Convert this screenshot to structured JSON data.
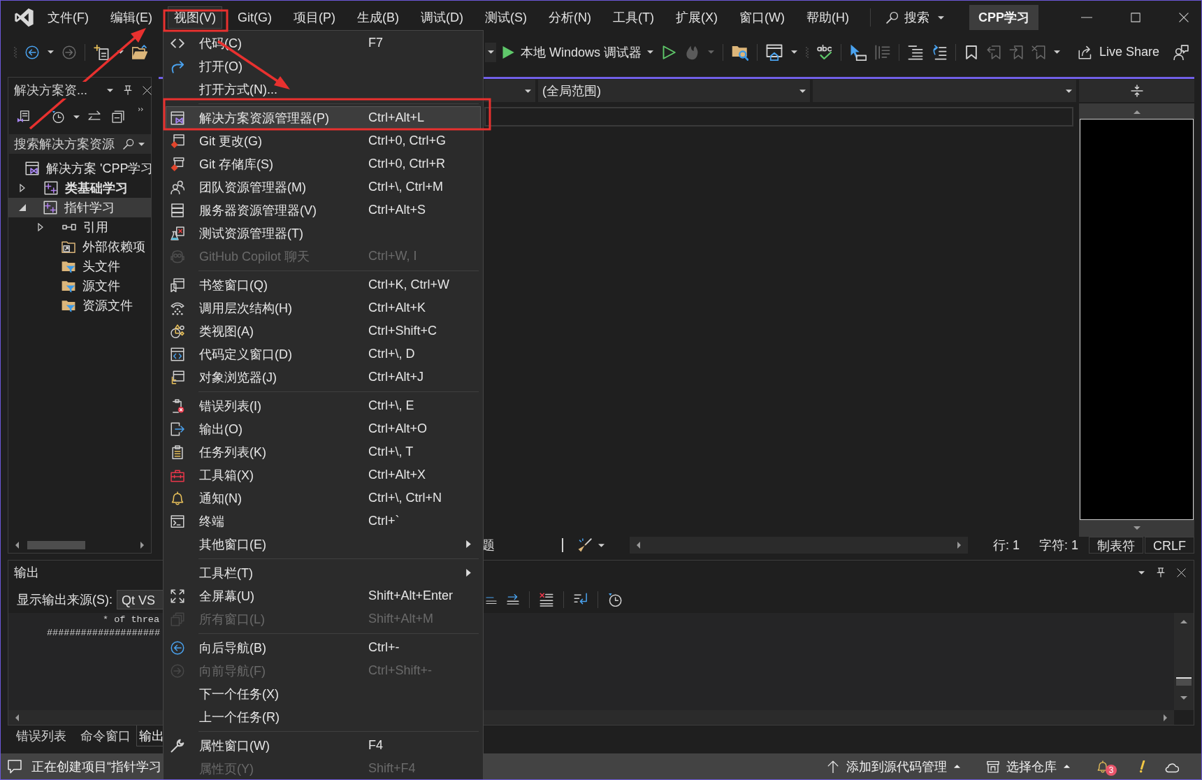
{
  "menu_bar": [
    {
      "label": "文件(F)",
      "selected": false
    },
    {
      "label": "编辑(E)",
      "selected": false
    },
    {
      "label": "视图(V)",
      "selected": true
    },
    {
      "label": "Git(G)",
      "selected": false
    },
    {
      "label": "项目(P)",
      "selected": false
    },
    {
      "label": "生成(B)",
      "selected": false
    },
    {
      "label": "调试(D)",
      "selected": false
    },
    {
      "label": "测试(S)",
      "selected": false
    },
    {
      "label": "分析(N)",
      "selected": false
    },
    {
      "label": "工具(T)",
      "selected": false
    },
    {
      "label": "扩展(X)",
      "selected": false
    },
    {
      "label": "窗口(W)",
      "selected": false
    },
    {
      "label": "帮助(H)",
      "selected": false
    }
  ],
  "search": {
    "label": "搜索"
  },
  "solution_name": "CPP学习",
  "toolbar": {
    "debug_target": "本地 Windows 调试器",
    "live_share": "Live Share"
  },
  "view_menu": {
    "groups": [
      {
        "items": [
          {
            "label": "代码(C)",
            "shortcut": "F7",
            "kind": "command",
            "disabled": false,
            "selected": false
          },
          {
            "label": "打开(O)",
            "kind": "command",
            "disabled": false,
            "selected": false
          },
          {
            "label": "打开方式(N)...",
            "kind": "command",
            "disabled": false,
            "selected": false
          }
        ]
      },
      {
        "items": [
          {
            "label": "解决方案资源管理器(P)",
            "shortcut": "Ctrl+Alt+L",
            "kind": "command",
            "disabled": false,
            "selected": true
          },
          {
            "label": "Git 更改(G)",
            "shortcut": "Ctrl+0, Ctrl+G",
            "kind": "command",
            "disabled": false,
            "selected": false
          },
          {
            "label": "Git 存储库(S)",
            "shortcut": "Ctrl+0, Ctrl+R",
            "kind": "command",
            "disabled": false,
            "selected": false
          },
          {
            "label": "团队资源管理器(M)",
            "shortcut": "Ctrl+\\, Ctrl+M",
            "kind": "command",
            "disabled": false,
            "selected": false
          },
          {
            "label": "服务器资源管理器(V)",
            "shortcut": "Ctrl+Alt+S",
            "kind": "command",
            "disabled": false,
            "selected": false
          },
          {
            "label": "测试资源管理器(T)",
            "kind": "command",
            "disabled": false,
            "selected": false
          },
          {
            "label": "GitHub Copilot 聊天",
            "shortcut": "Ctrl+W, I",
            "kind": "command",
            "disabled": true,
            "selected": false
          }
        ]
      },
      {
        "items": [
          {
            "label": "书签窗口(Q)",
            "shortcut": "Ctrl+K, Ctrl+W",
            "kind": "command",
            "disabled": false,
            "selected": false
          },
          {
            "label": "调用层次结构(H)",
            "shortcut": "Ctrl+Alt+K",
            "kind": "command",
            "disabled": false,
            "selected": false
          },
          {
            "label": "类视图(A)",
            "shortcut": "Ctrl+Shift+C",
            "kind": "command",
            "disabled": false,
            "selected": false
          },
          {
            "label": "代码定义窗口(D)",
            "shortcut": "Ctrl+\\, D",
            "kind": "command",
            "disabled": false,
            "selected": false
          },
          {
            "label": "对象浏览器(J)",
            "shortcut": "Ctrl+Alt+J",
            "kind": "command",
            "disabled": false,
            "selected": false
          }
        ]
      },
      {
        "items": [
          {
            "label": "错误列表(I)",
            "shortcut": "Ctrl+\\, E",
            "kind": "command",
            "disabled": false,
            "selected": false
          },
          {
            "label": "输出(O)",
            "shortcut": "Ctrl+Alt+O",
            "kind": "command",
            "disabled": false,
            "selected": false
          },
          {
            "label": "任务列表(K)",
            "shortcut": "Ctrl+\\, T",
            "kind": "command",
            "disabled": false,
            "selected": false
          },
          {
            "label": "工具箱(X)",
            "shortcut": "Ctrl+Alt+X",
            "kind": "command",
            "disabled": false,
            "selected": false
          },
          {
            "label": "通知(N)",
            "shortcut": "Ctrl+\\, Ctrl+N",
            "kind": "command",
            "disabled": false,
            "selected": false
          },
          {
            "label": "终端",
            "shortcut": "Ctrl+`",
            "kind": "command",
            "disabled": false,
            "selected": false
          },
          {
            "label": "其他窗口(E)",
            "kind": "submenu",
            "disabled": false,
            "selected": false
          }
        ]
      },
      {
        "items": [
          {
            "label": "工具栏(T)",
            "kind": "submenu",
            "disabled": false,
            "selected": false
          },
          {
            "label": "全屏幕(U)",
            "shortcut": "Shift+Alt+Enter",
            "kind": "command",
            "disabled": false,
            "selected": false
          },
          {
            "label": "所有窗口(L)",
            "shortcut": "Shift+Alt+M",
            "kind": "command",
            "disabled": true,
            "selected": false
          }
        ]
      },
      {
        "items": [
          {
            "label": "向后导航(B)",
            "shortcut": "Ctrl+-",
            "kind": "command",
            "disabled": false,
            "selected": false
          },
          {
            "label": "向前导航(F)",
            "shortcut": "Ctrl+Shift+-",
            "kind": "command",
            "disabled": true,
            "selected": false
          },
          {
            "label": "下一个任务(X)",
            "kind": "command",
            "disabled": false,
            "selected": false
          },
          {
            "label": "上一个任务(R)",
            "kind": "command",
            "disabled": false,
            "selected": false
          }
        ]
      },
      {
        "items": [
          {
            "label": "属性窗口(W)",
            "shortcut": "F4",
            "kind": "command",
            "disabled": false,
            "selected": false
          },
          {
            "label": "属性页(Y)",
            "shortcut": "Shift+F4",
            "kind": "command",
            "disabled": true,
            "selected": false
          }
        ]
      }
    ]
  },
  "solution_explorer": {
    "title": "解决方案资...",
    "search": {
      "placeholder": "搜索解决方案资源"
    },
    "tree": [
      {
        "label": "解决方案 'CPP学习",
        "kind": "solution",
        "bold": false,
        "selected": false,
        "children": [
          {
            "label": "类基础学习",
            "kind": "project",
            "expanded": false,
            "bold": true,
            "selected": false
          },
          {
            "label": "指针学习",
            "kind": "project",
            "expanded": true,
            "bold": false,
            "selected": true,
            "children": [
              {
                "label": "引用",
                "kind": "references",
                "expanded": false,
                "bold": false,
                "selected": false
              },
              {
                "label": "外部依赖项",
                "kind": "external",
                "bold": false,
                "selected": false
              },
              {
                "label": "头文件",
                "kind": "filter",
                "bold": false,
                "selected": false
              },
              {
                "label": "源文件",
                "kind": "filter",
                "bold": false,
                "selected": false
              },
              {
                "label": "资源文件",
                "kind": "filter",
                "bold": false,
                "selected": false
              }
            ]
          }
        ]
      }
    ]
  },
  "editor": {
    "scope": "(全局范围)",
    "status": {
      "message": "题",
      "line": "行: 1",
      "column": "字符: 1",
      "indent": "制表符",
      "line_ending": "CRLF"
    }
  },
  "output": {
    "title": "输出",
    "source_label": "显示输出来源(S):",
    "source_value": "Qt VS",
    "lines": [
      "* of threa",
      "####################"
    ]
  },
  "bottom_tabs": [
    {
      "label": "错误列表",
      "selected": false
    },
    {
      "label": "命令窗口",
      "selected": false
    },
    {
      "label": "输出",
      "selected": true
    }
  ],
  "status_bar": {
    "message": "正在创建项目“指针学习",
    "source_control": "添加到源代码管理",
    "repository": "选择仓库",
    "notifications": "3"
  }
}
